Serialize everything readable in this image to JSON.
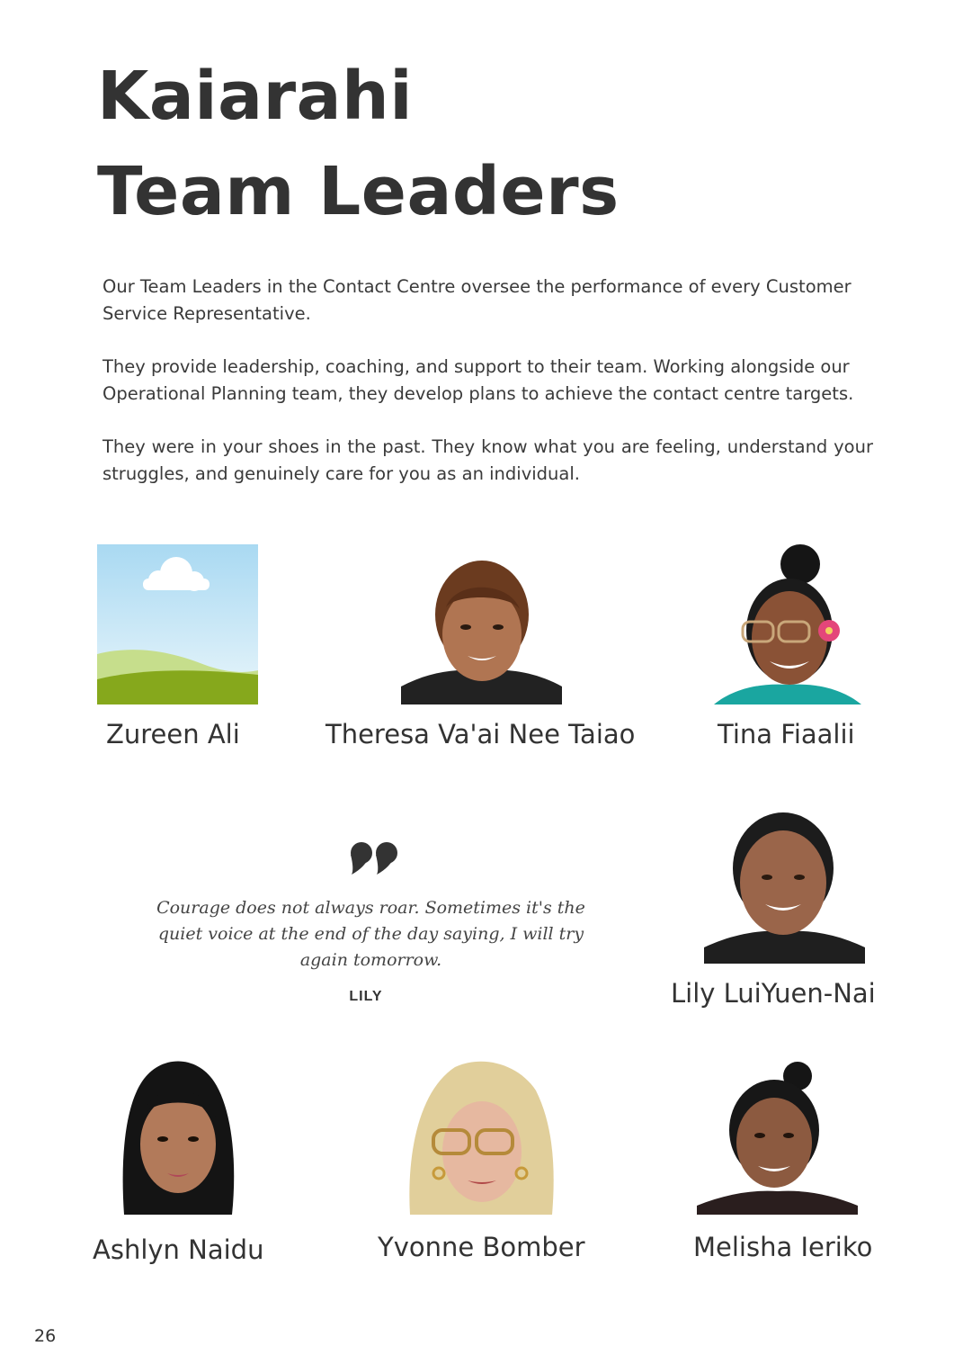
{
  "header": {
    "title_line1": "Kaiarahi",
    "title_line2": "Team Leaders"
  },
  "intro": {
    "p1": "Our Team Leaders in the Contact Centre oversee the performance of every Customer Service Representative.",
    "p2": "They provide leadership, coaching, and support to their team. Working alongside our Operational Planning team, they develop plans to achieve the contact centre targets.",
    "p3": "They were in your shoes in the past. They know what you are feeling, understand your struggles, and genuinely care for you as an individual."
  },
  "team": {
    "zureen": "Zureen Ali",
    "theresa": "Theresa Va'ai Nee Taiao",
    "tina": "Tina Fiaalii",
    "lily": "Lily LuiYuen-Nai",
    "ashlyn": "Ashlyn Naidu",
    "yvonne": "Yvonne Bomber",
    "melisha": "Melisha Ieriko"
  },
  "quote": {
    "text": "Courage does not always roar. Sometimes it's the quiet voice at the end of the day saying, I will try again tomorrow.",
    "author": "LILY"
  },
  "footer": {
    "page_number": "26"
  },
  "colors": {
    "text": "#333333",
    "sky": "#bfe3f5",
    "grass": "#86a81c"
  }
}
